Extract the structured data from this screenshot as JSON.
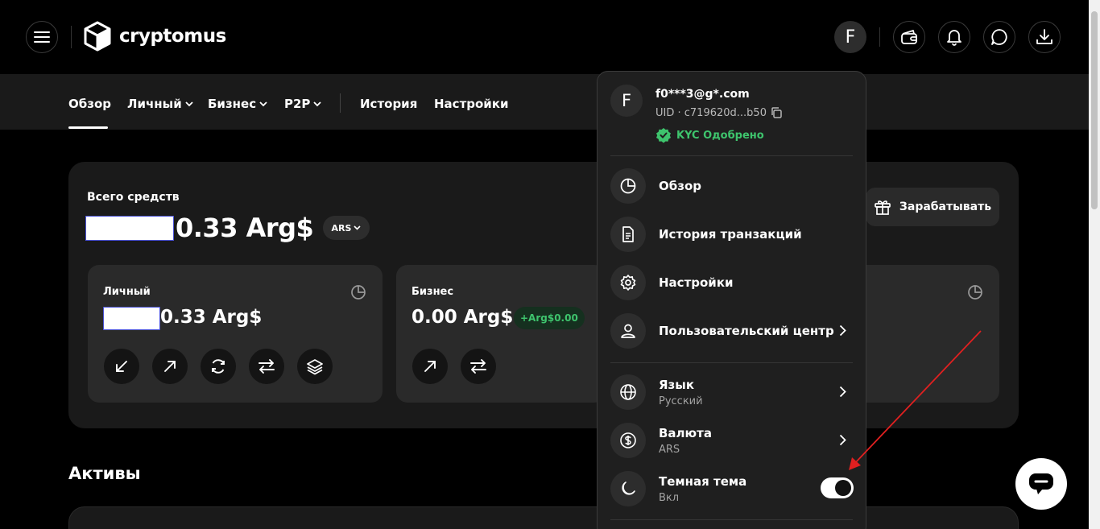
{
  "header": {
    "logo_text": "cryptomus",
    "avatar_letter": "F",
    "icons": [
      "wallet-icon",
      "bell-icon",
      "chat-icon",
      "download-icon"
    ]
  },
  "nav": {
    "items": [
      {
        "label": "Обзор",
        "dropdown": false,
        "active": true
      },
      {
        "label": "Личный",
        "dropdown": true
      },
      {
        "label": "Бизнес",
        "dropdown": true
      },
      {
        "label": "P2P",
        "dropdown": true
      },
      {
        "label": "История",
        "dropdown": false
      },
      {
        "label": "Настройки",
        "dropdown": false
      }
    ]
  },
  "overview": {
    "total_label": "Всего средств",
    "total_amount": "0.33 Arg$",
    "currency_pill": "ARS",
    "earn_button": "Зарабатывать",
    "cards": [
      {
        "label": "Личный",
        "amount": "0.33 Arg$",
        "actions": [
          "receive-icon",
          "send-icon",
          "exchange-icon",
          "transfer-icon",
          "staking-icon"
        ]
      },
      {
        "label": "Бизнес",
        "amount": "0.00 Arg$",
        "badge": "+Arg$0.00",
        "actions": [
          "send-icon",
          "transfer-icon"
        ]
      }
    ]
  },
  "assets": {
    "title": "Активы"
  },
  "profile_menu": {
    "avatar_letter": "F",
    "email": "f0***3@g*.com",
    "uid": "UID · c719620d...b50",
    "kyc": "KYC Одобрено",
    "items": [
      {
        "label": "Обзор",
        "icon": "pie-chart-icon"
      },
      {
        "label": "История транзакций",
        "icon": "document-icon"
      },
      {
        "label": "Настройки",
        "icon": "gear-icon"
      },
      {
        "label": "Пользовательский центр",
        "icon": "user-icon",
        "chevron": true
      }
    ],
    "settings": [
      {
        "label": "Язык",
        "value": "Русский",
        "icon": "globe-icon",
        "chevron": true
      },
      {
        "label": "Валюта",
        "value": "ARS",
        "icon": "dollar-icon",
        "chevron": true
      },
      {
        "label": "Темная тема",
        "value": "Вкл",
        "icon": "moon-icon",
        "toggle": true,
        "toggle_on": true
      }
    ]
  },
  "colors": {
    "background": "#000000",
    "panel": "#1a1a1a",
    "card": "#2a2a2a",
    "accent_green": "#3ec46d",
    "annotation_arrow": "#e02020"
  }
}
